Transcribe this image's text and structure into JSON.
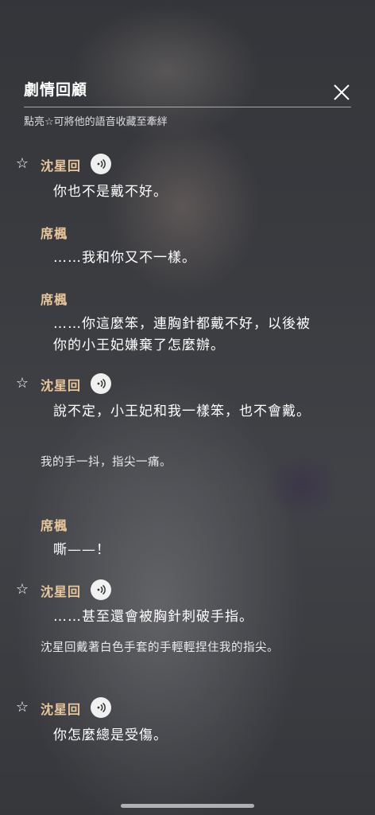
{
  "header": {
    "title": "劇情回顧",
    "hint": "點亮☆可將他的語音收藏至牽絆"
  },
  "icons": {
    "star": "star-outline-icon",
    "voice": "voice-play-icon",
    "close": "close-icon"
  },
  "colors": {
    "speaker": "#e9c79b",
    "text": "#ffffff"
  },
  "entries": [
    {
      "speaker": "沈星回",
      "line": "你也不是戴不好。"
    },
    {
      "speaker": "席楓",
      "line": "……我和你又不一樣。"
    },
    {
      "speaker": "席楓",
      "line": "……你這麼笨，連胸針都戴不好，以後被你的小王妃嫌棄了怎麼辦。"
    },
    {
      "speaker": "沈星回",
      "line": "說不定，小王妃和我一樣笨，也不會戴。"
    },
    {
      "narration": "我的手一抖，指尖一痛。"
    },
    {
      "speaker": "席楓",
      "line": "嘶——！"
    },
    {
      "speaker": "沈星回",
      "line": "……甚至還會被胸針刺破手指。"
    },
    {
      "narration": "沈星回戴著白色手套的手輕輕捏住我的指尖。"
    },
    {
      "speaker": "沈星回",
      "line": "你怎麼總是受傷。"
    }
  ]
}
